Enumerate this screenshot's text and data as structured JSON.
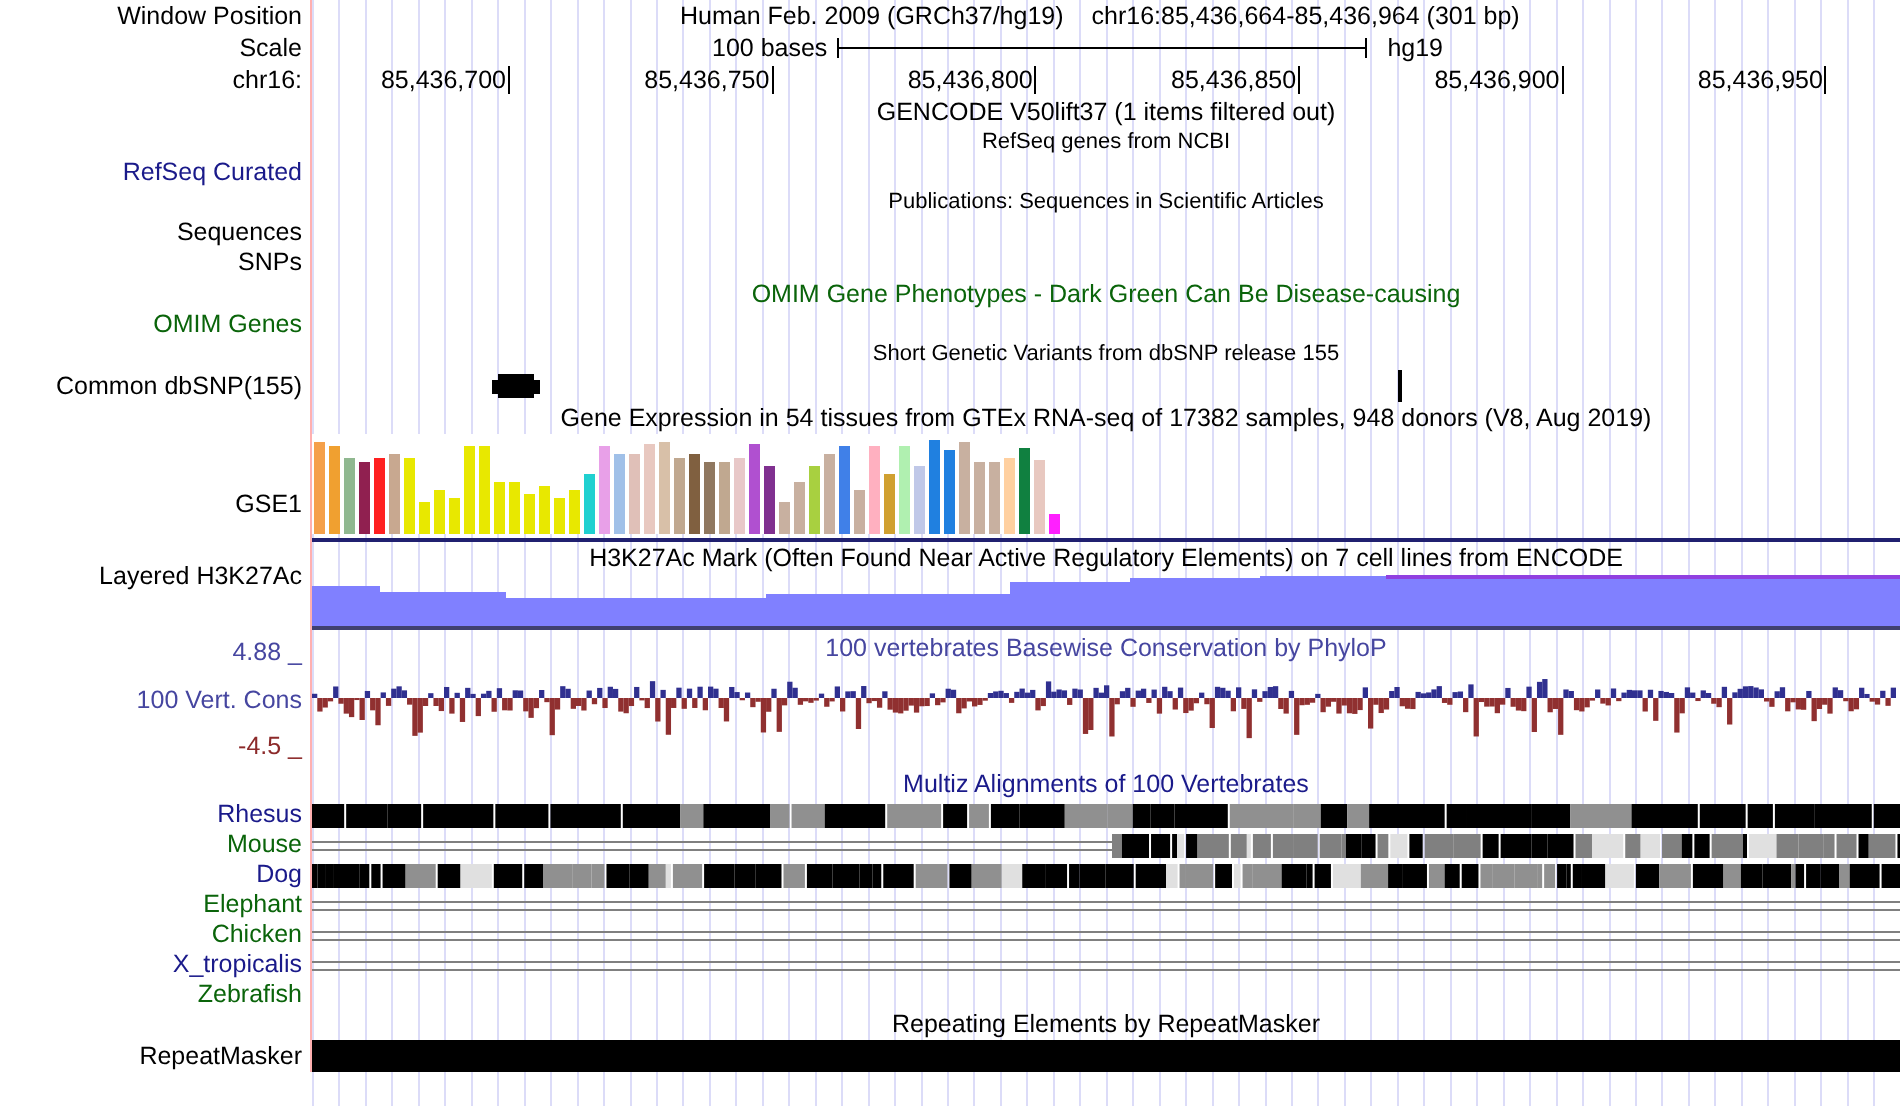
{
  "header": {
    "window_position": {
      "label": "Window Position",
      "assembly": "Human Feb. 2009 (GRCh37/hg19)",
      "range": "chr16:85,436,664-85,436,964 (301 bp)"
    },
    "scale": {
      "label": "Scale",
      "bar_text": "100 bases",
      "assembly": "hg19"
    },
    "ruler": {
      "label": "chr16:",
      "ticks": [
        "85,436,700",
        "85,436,750",
        "85,436,800",
        "85,436,850",
        "85,436,900",
        "85,436,950"
      ]
    }
  },
  "tracks": [
    {
      "kind": "title",
      "text": "GENCODE V50lift37 (1 items filtered out)",
      "color": "#000000"
    },
    {
      "kind": "small_title",
      "text": "RefSeq genes from NCBI"
    },
    {
      "kind": "label",
      "label": "RefSeq Curated",
      "color": "#1a1a8a"
    },
    {
      "kind": "small_title",
      "text": "Publications: Sequences in Scientific Articles"
    },
    {
      "kind": "label",
      "label": "Sequences",
      "color": "#000000"
    },
    {
      "kind": "label",
      "label": "SNPs",
      "color": "#000000"
    },
    {
      "kind": "title",
      "text": "OMIM Gene Phenotypes - Dark Green Can Be Disease-causing",
      "color": "#0a640a"
    },
    {
      "kind": "label",
      "label": "OMIM Genes",
      "color": "#0a640a"
    },
    {
      "kind": "small_title",
      "text": "Short Genetic Variants from dbSNP release 155"
    },
    {
      "kind": "snp",
      "label": "Common dbSNP(155)"
    },
    {
      "kind": "title",
      "text": "Gene Expression in 54 tissues from GTEx RNA-seq of 17382 samples, 948 donors (V8, Aug 2019)",
      "color": "#000000"
    },
    {
      "kind": "gtex",
      "label": "GSE1"
    },
    {
      "kind": "layered",
      "label": "Layered H3K27Ac",
      "title": "H3K27Ac Mark (Often Found Near Active Regulatory Elements) on 7 cell lines from ENCODE"
    },
    {
      "kind": "conservation",
      "label": "100 Vert. Cons",
      "max": {
        "text": "4.88 _",
        "color": "#4646a0"
      },
      "min": {
        "text": "-4.5 _",
        "color": "#8c2a2a"
      },
      "title": "100 vertebrates Basewise Conservation by PhyloP",
      "color": "#4646a0"
    },
    {
      "kind": "multiz",
      "title": "Multiz Alignments of 100 Vertebrates",
      "species": [
        {
          "name": "Rhesus",
          "color": "#1a1a8a",
          "kind": "blocks"
        },
        {
          "name": "Mouse",
          "color": "#0a640a",
          "kind": "partial"
        },
        {
          "name": "Dog",
          "color": "#1a1a8a",
          "kind": "mixed"
        },
        {
          "name": "Elephant",
          "color": "#0a640a",
          "kind": "lines"
        },
        {
          "name": "Chicken",
          "color": "#0a640a",
          "kind": "lines"
        },
        {
          "name": "X_tropicalis",
          "color": "#1a1a8a",
          "kind": "lines"
        },
        {
          "name": "Zebrafish",
          "color": "#0a640a",
          "kind": "empty"
        }
      ]
    },
    {
      "kind": "repeat",
      "title": "Repeating Elements by RepeatMasker",
      "label": "RepeatMasker"
    }
  ]
}
